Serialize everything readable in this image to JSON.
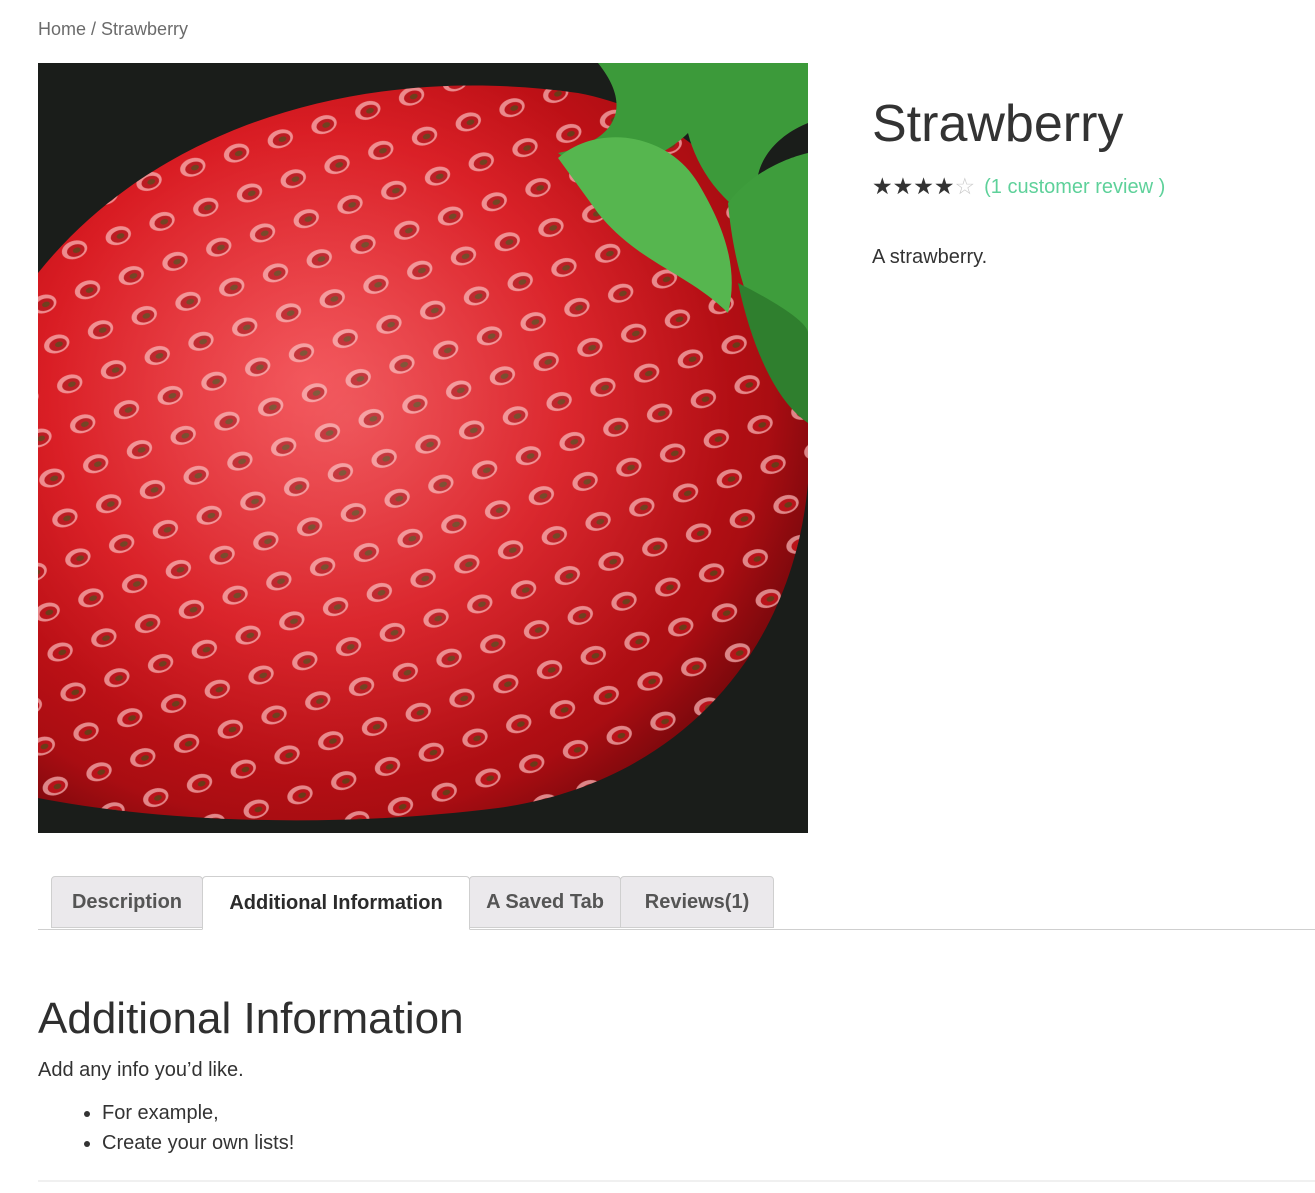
{
  "breadcrumb": {
    "home": "Home",
    "separator": "/",
    "current": "Strawberry"
  },
  "product": {
    "title": "Strawberry",
    "rating": {
      "value": 4,
      "max": 5,
      "filled_stars": "★★★★★",
      "empty_stars": "☆☆☆☆☆"
    },
    "review_link": "(1 customer review )",
    "short_description": "A strawberry.",
    "image_icon": "strawberry-photo"
  },
  "tabs": [
    {
      "label": "Description",
      "active": false
    },
    {
      "label": "Additional Information",
      "active": true
    },
    {
      "label": "A Saved Tab",
      "active": false
    },
    {
      "label": "Reviews(1)",
      "active": false
    }
  ],
  "panel": {
    "heading": "Additional Information",
    "text": "Add any info you’d like.",
    "list": [
      "For example,",
      "Create your own lists!"
    ]
  },
  "colors": {
    "link": "#5ed19a",
    "tab_inactive_bg": "#ebe9ec",
    "text": "#333333"
  }
}
